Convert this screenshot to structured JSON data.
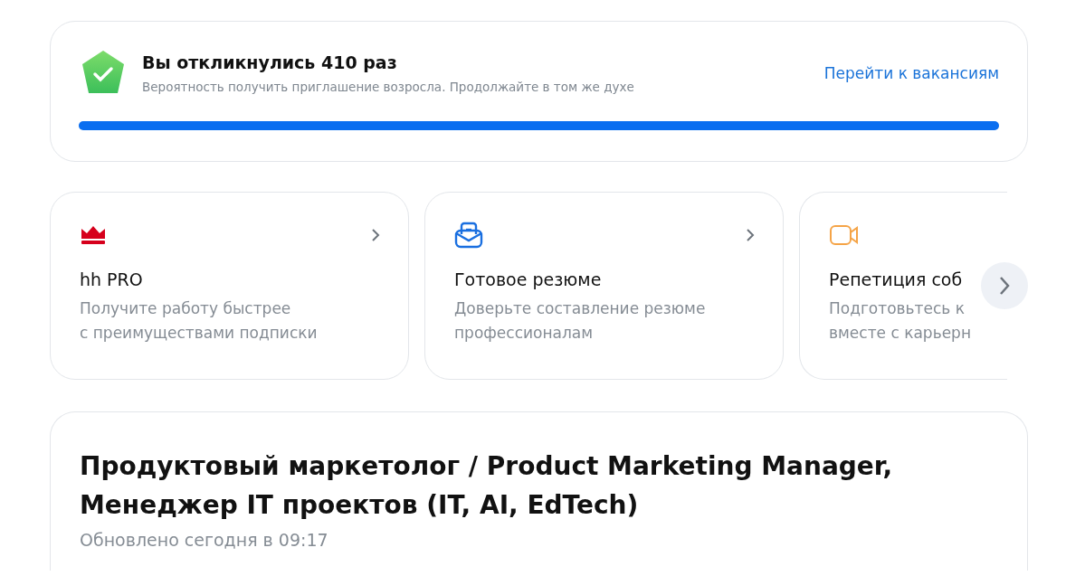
{
  "responses": {
    "title": "Вы откликнулись 410 раз",
    "subtitle": "Вероятность получить приглашение возросла. Продолжайте в том же духе",
    "link": "Перейти к вакансиям",
    "level": 1
  },
  "services": [
    {
      "kind": "crown",
      "title": "hh PRO",
      "lines": [
        "Получите работу быстрее",
        "с преимуществами подписки"
      ],
      "cut": false
    },
    {
      "kind": "envelope",
      "title": "Готовое резюме",
      "lines": [
        "Доверьте составление резюме",
        "профессионалам"
      ],
      "cut": false
    },
    {
      "kind": "camera",
      "title": "Репетиция соб",
      "lines": [
        "Подготовьтесь к",
        "вместе с карьерн"
      ],
      "cut": true
    }
  ],
  "resume": {
    "title": "Продуктовый маркетолог / Product Marketing Manager, Менеджер IT проектов (IT, AI, EdTech)",
    "updated": "Обновлено сегодня в 09:17"
  }
}
